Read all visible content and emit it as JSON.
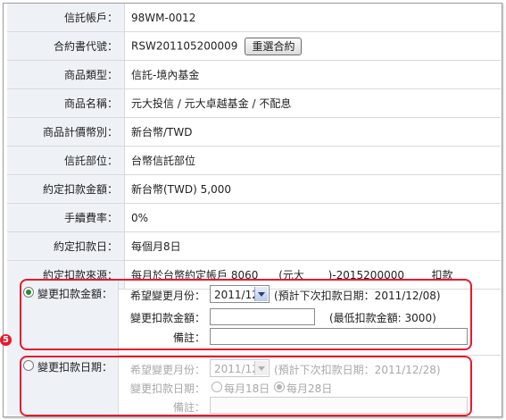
{
  "rows": [
    {
      "label": "信託帳戶：",
      "value": "98WM-0012"
    },
    {
      "label": "合約書代號：",
      "value": "RSW201105200009",
      "button": "重選合約"
    },
    {
      "label": "商品類型：",
      "value": "信託-境內基金"
    },
    {
      "label": "商品名稱：",
      "value": "元大投信 / 元大卓越基金 / 不配息"
    },
    {
      "label": "商品計價幣別：",
      "value": "新台幣/TWD"
    },
    {
      "label": "信託部位：",
      "value": "台幣信託部位"
    },
    {
      "label": "約定扣款金額：",
      "value": "新台幣(TWD) 5,000"
    },
    {
      "label": "手續費率：",
      "value": "0%"
    },
    {
      "label": "約定扣款日：",
      "value": "每個月8日"
    },
    {
      "label": "約定扣款來源：",
      "value": "每月於台幣約定帳戶 8060      (元大       )-2015200000        扣款"
    }
  ],
  "change_amount": {
    "option_label": "變更扣款金額：",
    "selected": true,
    "month_label": "希望變更月份：",
    "month_value": "2011/12",
    "month_note": "(預計下次扣款日期：2011/12/08)",
    "amount_label": "變更扣款金額：",
    "amount_value": "",
    "amount_note": "(最低扣款金額: 3000)",
    "remark_label": "備註：",
    "remark_value": ""
  },
  "change_date": {
    "option_label": "變更扣款日期：",
    "selected": false,
    "month_label": "希望變更月份：",
    "month_value": "2011/12",
    "month_note": "(預計下次扣款日期：2011/12/28)",
    "date_label": "變更扣款日期：",
    "date_option1": "每月18日",
    "date_option2": "每月28日",
    "date_option2_selected": true,
    "remark_label": "備註："
  },
  "step_number": "5",
  "colors": {
    "label_bg": "#eef2f7",
    "highlight": "#e8192c",
    "radio_on": "#2a8a2a"
  }
}
